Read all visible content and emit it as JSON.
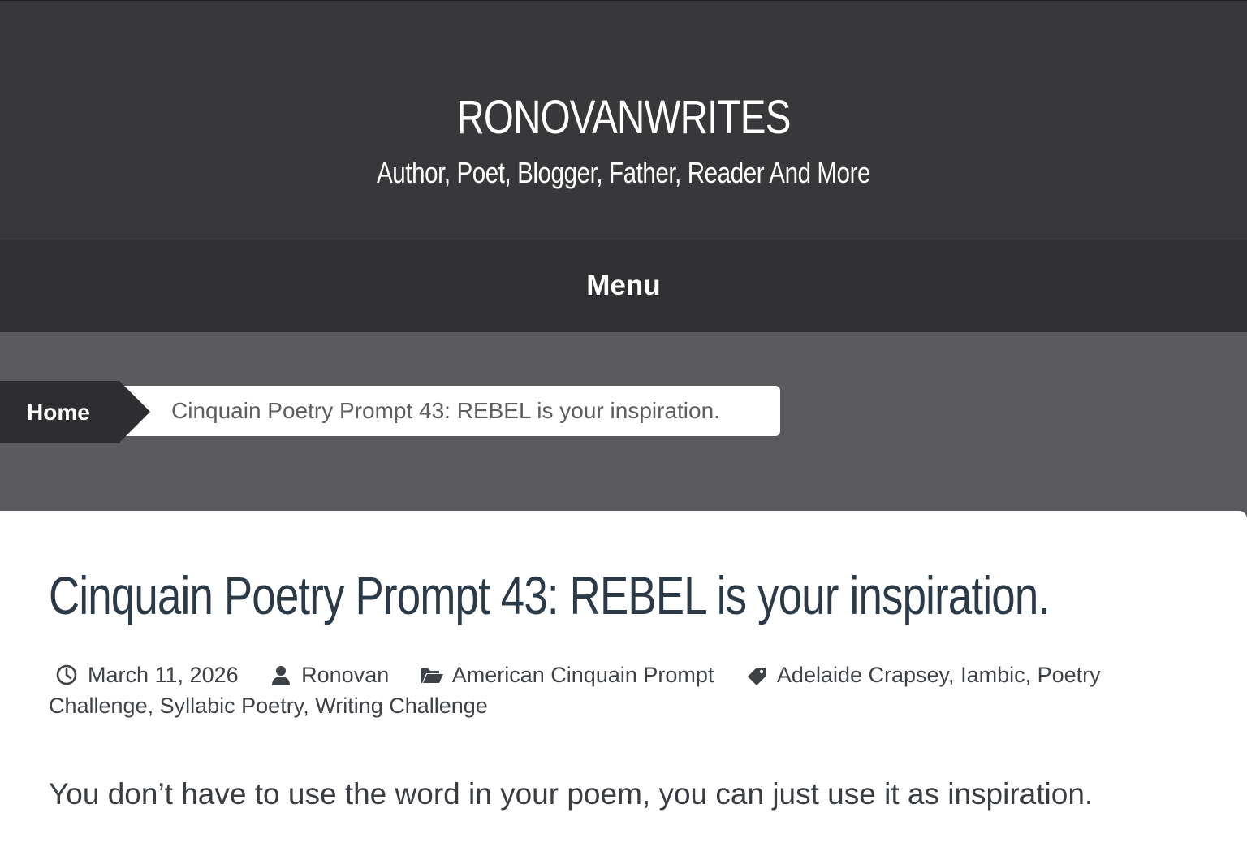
{
  "header": {
    "site_title": "RONOVANWRITES",
    "tagline": "Author, Poet, Blogger, Father, Reader And More"
  },
  "nav": {
    "menu_label": "Menu"
  },
  "breadcrumb": {
    "home_label": "Home",
    "current_label": "Cinquain Poetry Prompt 43: REBEL is your inspiration."
  },
  "post": {
    "title": "Cinquain Poetry Prompt 43: REBEL is your inspiration.",
    "meta": {
      "date": "March 11, 2026",
      "author": "Ronovan",
      "category": "American Cinquain Prompt",
      "tags": [
        "Adelaide Crapsey",
        "Iambic",
        "Poetry Challenge",
        "Syllabic Poetry",
        "Writing Challenge"
      ]
    },
    "body_first_paragraph": "You don’t have to use the word in your poem, you can just use it as inspiration."
  },
  "icons": {
    "date": "clock-icon",
    "author": "user-icon",
    "category": "folder-open-icon",
    "tags": "tag-icon"
  },
  "colors": {
    "header_bg": "#38383a",
    "nav_bg": "#303032",
    "breadcrumb_area_bg": "#5b5a5e",
    "home_crumb_bg": "#2e2e30",
    "title_color": "#2c3a48"
  }
}
